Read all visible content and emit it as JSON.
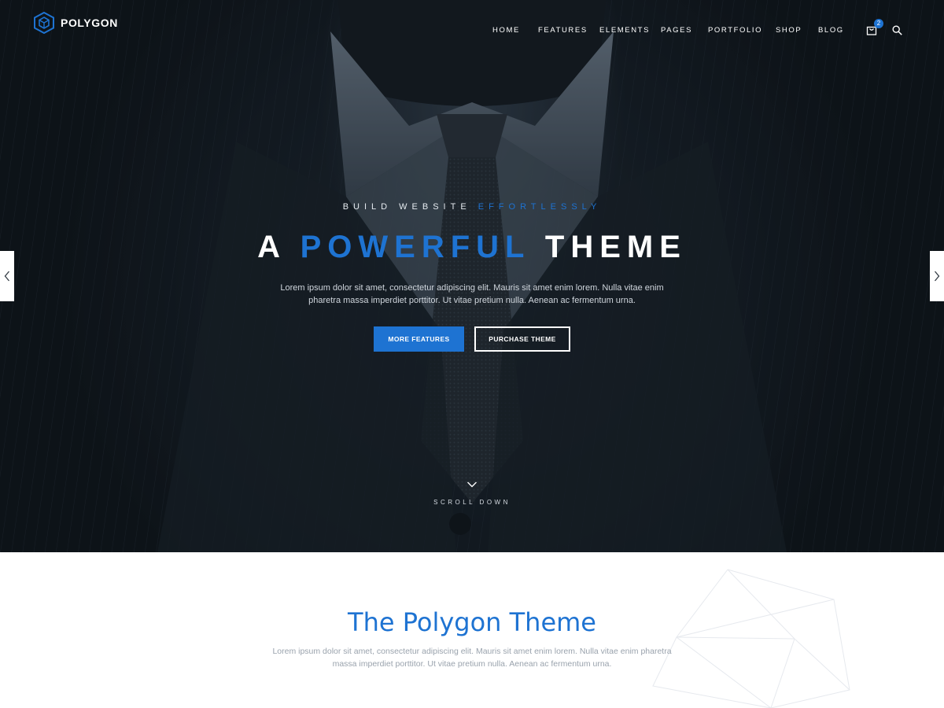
{
  "brand": {
    "name": "POLYGON",
    "accent_color": "#1e73d2"
  },
  "nav": {
    "items": [
      "HOME",
      "FEATURES",
      "ELEMENTS",
      "PAGES",
      "PORTFOLIO",
      "SHOP",
      "BLOG"
    ],
    "cart_icon": "shopping-bag-icon",
    "cart_count": "2",
    "search_icon": "search-icon"
  },
  "hero": {
    "kicker_main": "BUILD WEBSITE ",
    "kicker_accent": "EFFORTLESSLY",
    "headline_pre": "A ",
    "headline_accent": "POWERFUL",
    "headline_post": " THEME",
    "description": "Lorem ipsum dolor sit amet, consectetur adipiscing elit. Mauris sit amet enim lorem. Nulla vitae enim pharetra massa imperdiet porttitor. Ut vitae pretium nulla. Aenean ac fermentum urna.",
    "primary_button": "MORE FEATURES",
    "secondary_button": "PURCHASE THEME",
    "scroll_label": "SCROLL DOWN",
    "scroll_icon": "chevron-down-icon",
    "prev_icon": "chevron-left-icon",
    "next_icon": "chevron-right-icon"
  },
  "intro": {
    "title": "The Polygon Theme",
    "description": "Lorem ipsum dolor sit amet, consectetur adipiscing elit. Mauris sit amet enim lorem. Nulla vitae enim pharetra massa imperdiet porttitor. Ut vitae pretium nulla. Aenean ac fermentum urna."
  }
}
